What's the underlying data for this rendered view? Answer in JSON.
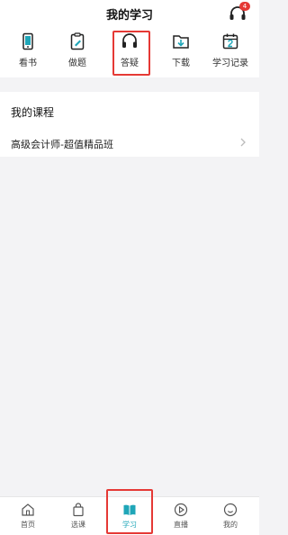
{
  "header": {
    "title": "我的学习",
    "badge_count": "4",
    "icon": "headset-icon"
  },
  "quick_actions": [
    {
      "label": "看书",
      "icon": "phone-book-icon"
    },
    {
      "label": "做题",
      "icon": "clipboard-edit-icon"
    },
    {
      "label": "答疑",
      "icon": "headphones-icon"
    },
    {
      "label": "下载",
      "icon": "folder-download-icon"
    },
    {
      "label": "学习记录",
      "icon": "calendar-icon"
    }
  ],
  "courses": {
    "title": "我的课程",
    "items": [
      {
        "name": "高级会计师-超值精品班"
      }
    ]
  },
  "tabbar": {
    "items": [
      {
        "label": "首页",
        "icon": "home-icon"
      },
      {
        "label": "选课",
        "icon": "bag-icon"
      },
      {
        "label": "学习",
        "icon": "open-book-icon",
        "active": true
      },
      {
        "label": "直播",
        "icon": "play-circle-icon"
      },
      {
        "label": "我的",
        "icon": "smiley-user-icon"
      }
    ]
  },
  "colors": {
    "accent": "#1fa6b8",
    "highlight": "#e53935",
    "badge": "#e53935"
  }
}
